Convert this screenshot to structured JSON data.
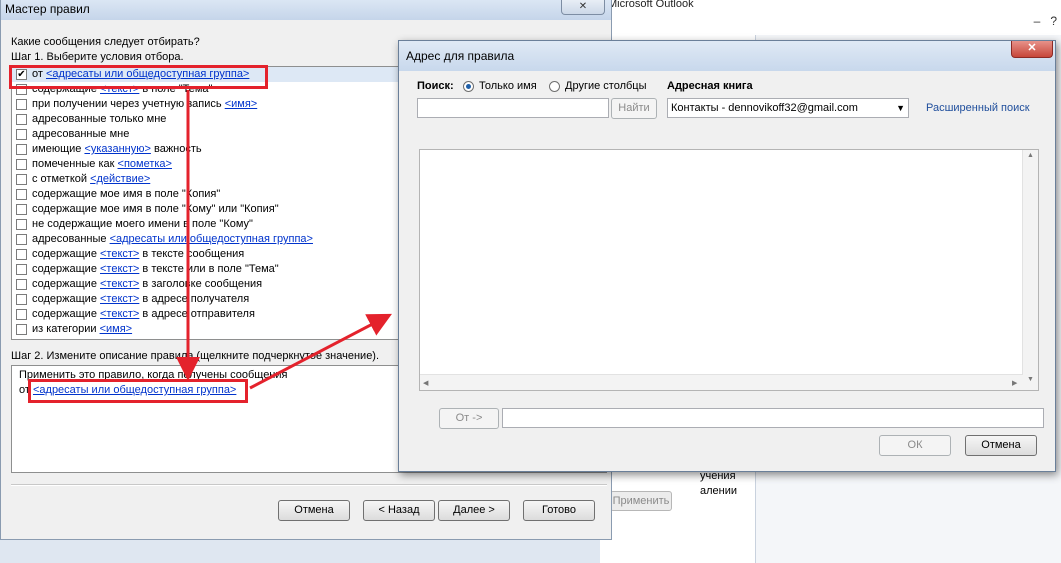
{
  "background": {
    "outlook_title": "Microsoft Outlook",
    "apply_label": "Применить",
    "partial_lines": [
      "учения",
      "алении"
    ]
  },
  "wizard": {
    "title": "Мастер правил",
    "close_glyph": "✕",
    "question": "Какие сообщения следует отбирать?",
    "step1": "Шаг 1. Выберите условия отбора.",
    "conditions": [
      {
        "pre": "от ",
        "link": "<адресаты или общедоступная группа>",
        "post": "",
        "checked": true
      },
      {
        "pre": "содержащие ",
        "link": "<текст>",
        "post": " в поле \"Тема\"",
        "checked": false
      },
      {
        "pre": "при получении через учетную запись ",
        "link": "<имя>",
        "post": "",
        "checked": false
      },
      {
        "pre": "адресованные только мне",
        "link": "",
        "post": "",
        "checked": false
      },
      {
        "pre": "адресованные мне",
        "link": "",
        "post": "",
        "checked": false
      },
      {
        "pre": "имеющие ",
        "link": "<указанную>",
        "post": " важность",
        "checked": false
      },
      {
        "pre": "помеченные как ",
        "link": "<пометка>",
        "post": "",
        "checked": false
      },
      {
        "pre": "с отметкой ",
        "link": "<действие>",
        "post": "",
        "checked": false
      },
      {
        "pre": "содержащие мое имя в поле \"Копия\"",
        "link": "",
        "post": "",
        "checked": false
      },
      {
        "pre": "содержащие мое имя в поле \"Кому\" или \"Копия\"",
        "link": "",
        "post": "",
        "checked": false
      },
      {
        "pre": "не содержащие моего имени в поле \"Кому\"",
        "link": "",
        "post": "",
        "checked": false
      },
      {
        "pre": "адресованные ",
        "link": "<адресаты или общедоступная группа>",
        "post": "",
        "checked": false
      },
      {
        "pre": "содержащие ",
        "link": "<текст>",
        "post": " в тексте сообщения",
        "checked": false
      },
      {
        "pre": "содержащие ",
        "link": "<текст>",
        "post": " в тексте или в поле \"Тема\"",
        "checked": false
      },
      {
        "pre": "содержащие ",
        "link": "<текст>",
        "post": " в заголовке сообщения",
        "checked": false
      },
      {
        "pre": "содержащие ",
        "link": "<текст>",
        "post": " в адресе получателя",
        "checked": false
      },
      {
        "pre": "содержащие ",
        "link": "<текст>",
        "post": " в адресе отправителя",
        "checked": false
      },
      {
        "pre": "из категории ",
        "link": "<имя>",
        "post": "",
        "checked": false
      }
    ],
    "step2": "Шаг 2. Измените описание правила (щелкните подчеркнутое значение).",
    "desc_line1": "Применить это правило, когда получены сообщения",
    "desc_line2_pre": "от ",
    "desc_line2_link": "<адресаты или общедоступная группа>",
    "buttons": {
      "cancel": "Отмена",
      "back": "< Назад",
      "next": "Далее >",
      "finish": "Готово"
    }
  },
  "address_dialog": {
    "title": "Адрес для правила",
    "close_glyph": "✕",
    "search_label": "Поиск:",
    "radio_name_only": "Только имя",
    "radio_other_columns": "Другие столбцы",
    "address_book_label": "Адресная книга",
    "search_value": "",
    "find_button": "Найти",
    "address_book_value": "Контакты - dennovikoff32@gmail.com",
    "advanced_search": "Расширенный поиск",
    "from_button": "От ->",
    "from_value": "",
    "ok": "ОК",
    "cancel": "Отмена"
  },
  "colors": {
    "annotation_red": "#e4222c",
    "link_blue": "#0033cc"
  }
}
